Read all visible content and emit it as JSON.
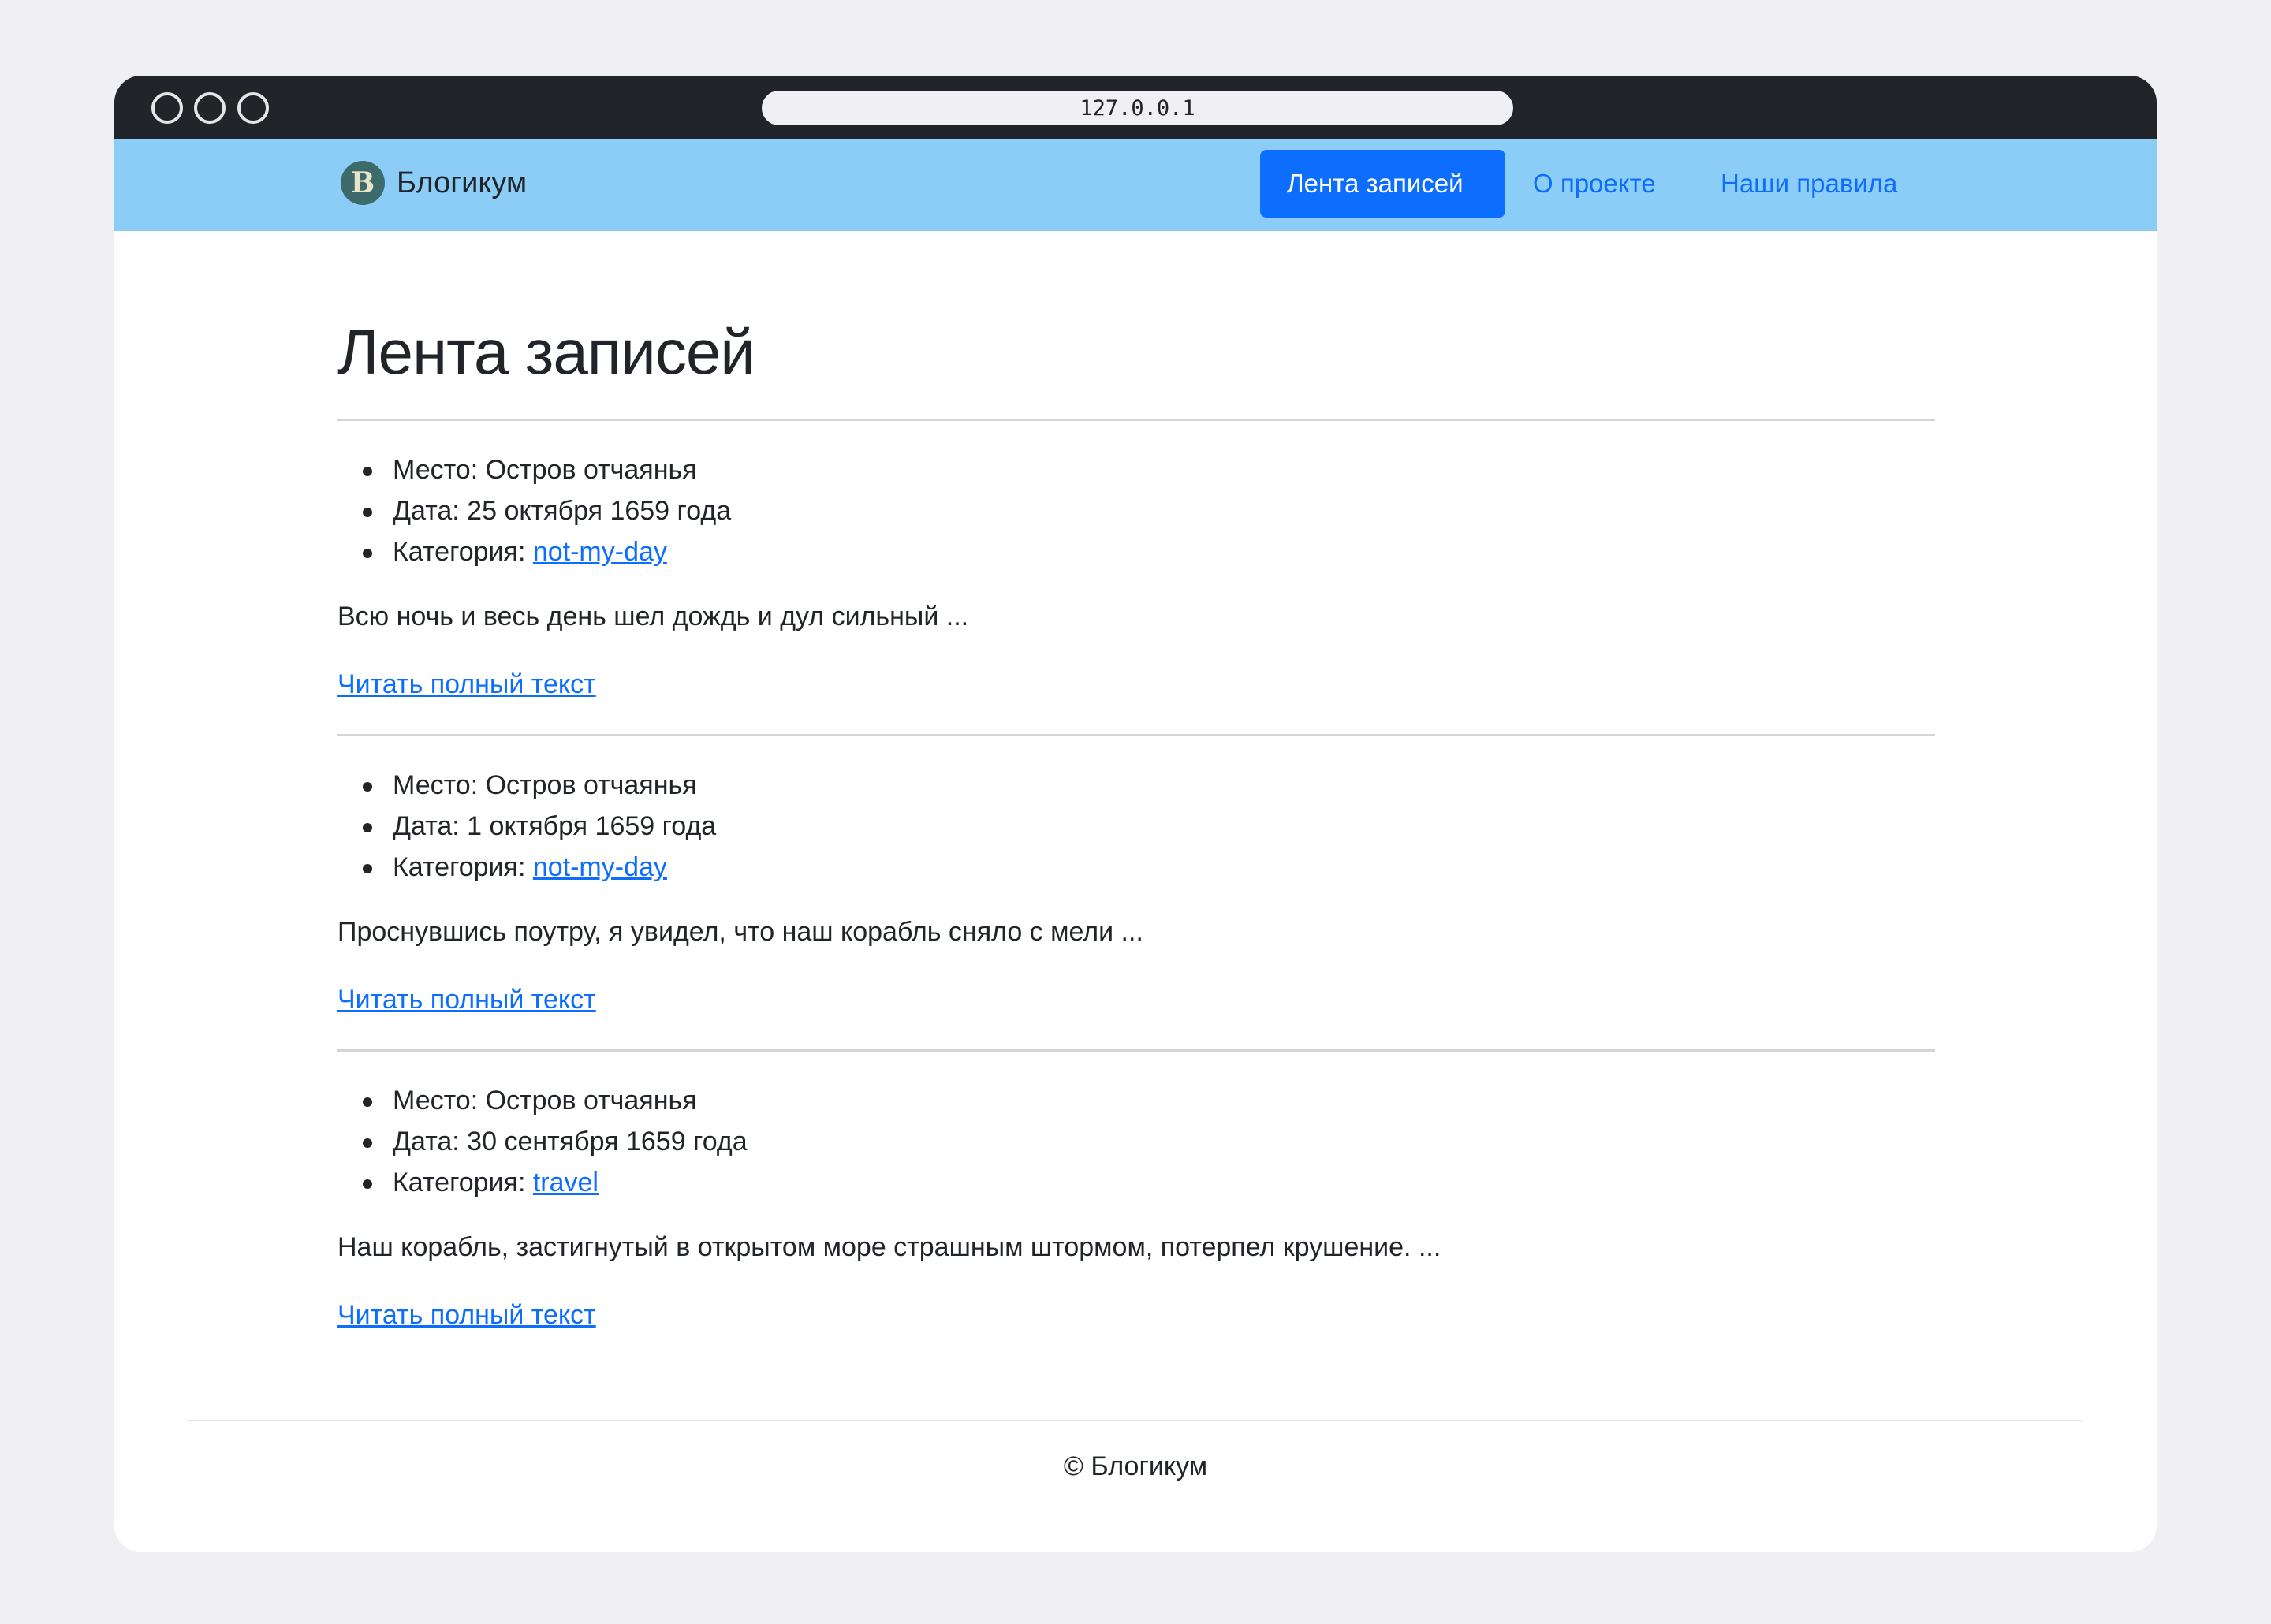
{
  "browser": {
    "url": "127.0.0.1"
  },
  "navbar": {
    "brand_logo_letter": "B",
    "brand_name": "Блогикум",
    "items": [
      {
        "label": "Лента записей",
        "active": true
      },
      {
        "label": "О проекте",
        "active": false
      },
      {
        "label": "Наши правила",
        "active": false
      }
    ]
  },
  "main": {
    "title": "Лента записей",
    "posts": [
      {
        "place": "Место: Остров отчаянья",
        "date": "Дата: 25 октября 1659 года",
        "category_prefix": "Категория: ",
        "category": "not-my-day",
        "excerpt": "Всю ночь и весь день шел дождь и дул сильный ...",
        "read_more": "Читать полный текст"
      },
      {
        "place": "Место: Остров отчаянья",
        "date": "Дата: 1 октября 1659 года",
        "category_prefix": "Категория: ",
        "category": "not-my-day",
        "excerpt": "Проснувшись поутру, я увидел, что наш корабль сняло с мели ...",
        "read_more": "Читать полный текст"
      },
      {
        "place": "Место: Остров отчаянья",
        "date": "Дата: 30 сентября 1659 года",
        "category_prefix": "Категория: ",
        "category": "travel",
        "excerpt": "Наш корабль, застигнутый в открытом море страшным штормом, потерпел крушение. ...",
        "read_more": "Читать полный текст"
      }
    ]
  },
  "footer": {
    "text": "© Блогикум"
  },
  "colors": {
    "navbar_bg": "#8ccdf8",
    "accent": "#0d6efd",
    "titlebar": "#212428",
    "page_bg": "#efeff4"
  }
}
